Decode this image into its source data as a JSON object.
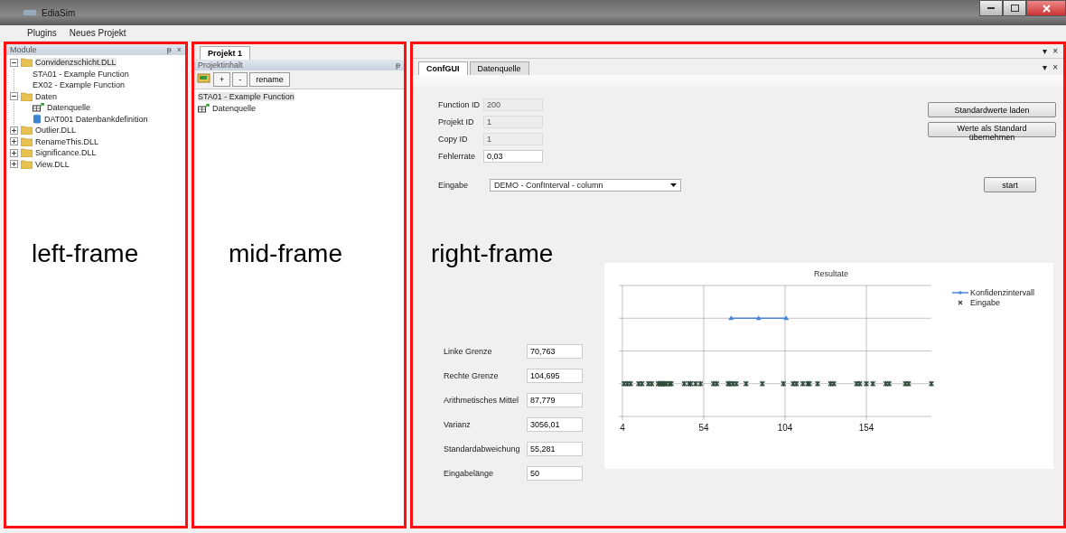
{
  "window": {
    "title": "EdiaSim"
  },
  "menu": [
    "Plugins",
    "Neues Projekt"
  ],
  "left_panel": {
    "title": "Module",
    "pin": "ᵽ",
    "close": "×",
    "annotation": "left-frame",
    "tree": [
      {
        "label": "Convidenzschicht.DLL",
        "kind": "folder",
        "expanded": true,
        "selected": true,
        "children": [
          {
            "label": "STA01 - Example Function",
            "kind": "function",
            "selected": false
          },
          {
            "label": "EX02 - Example Function",
            "kind": "function",
            "selected": false
          }
        ]
      },
      {
        "label": "Daten",
        "kind": "folder",
        "expanded": true,
        "selected": false,
        "children": [
          {
            "label": "Datenquelle",
            "kind": "source",
            "selected": false
          },
          {
            "label": "DAT001 Datenbankdefinition",
            "kind": "database",
            "selected": false
          }
        ]
      },
      {
        "label": "Outlier.DLL",
        "kind": "folder",
        "expanded": false,
        "selected": false
      },
      {
        "label": "RenameThis.DLL",
        "kind": "folder",
        "expanded": false,
        "selected": false
      },
      {
        "label": "Significance.DLL",
        "kind": "folder",
        "expanded": false,
        "selected": false
      },
      {
        "label": "View.DLL",
        "kind": "folder",
        "expanded": false,
        "selected": false
      }
    ]
  },
  "mid_panel": {
    "tabs": [
      {
        "label": "Projekt 1",
        "selected": true
      }
    ],
    "title": "Projektinhalt",
    "pin": "ᵽ",
    "annotation": "mid-frame",
    "toolbar": [
      "+",
      "-",
      "rename"
    ],
    "tree": [
      {
        "label": "STA01 - Example Function",
        "kind": "function",
        "selected": true
      },
      {
        "label": "Datenquelle",
        "kind": "source",
        "selected": false
      }
    ]
  },
  "right_panel": {
    "annotation": "right-frame",
    "top_controls": [
      "▾",
      "×"
    ],
    "tab_controls": [
      "▾",
      "×"
    ],
    "tabs": [
      {
        "label": "ConfGUI",
        "selected": true
      },
      {
        "label": "Datenquelle",
        "selected": false
      }
    ],
    "fields": [
      {
        "label": "Function ID",
        "value": "200",
        "disabled": true
      },
      {
        "label": "Projekt ID",
        "value": "1",
        "disabled": true
      },
      {
        "label": "Copy ID",
        "value": "1",
        "disabled": true
      },
      {
        "label": "Fehlerrate",
        "value": "0,03",
        "disabled": false
      }
    ],
    "buttons": [
      "Standardwerte laden",
      "Werte als Standard übernehmen"
    ],
    "input_select": {
      "label": "Eingabe",
      "value": "DEMO - ConfInterval - column"
    },
    "start_button": "start",
    "results": [
      {
        "label": "Linke Grenze",
        "value": "70,763"
      },
      {
        "label": "Rechte Grenze",
        "value": "104,695"
      },
      {
        "label": "Arithmetisches Mittel",
        "value": "87,779"
      },
      {
        "label": "Varianz",
        "value": "3056,01"
      },
      {
        "label": "Standardabweichung",
        "value": "55,281"
      },
      {
        "label": "Eingabelänge",
        "value": "50"
      }
    ],
    "chart": {
      "title": "Resultate",
      "x_tick_labels": [
        "4",
        "54",
        "104",
        "154"
      ],
      "legend": [
        {
          "label": "Konfidenzintervall",
          "color": "#4a86d8"
        },
        {
          "label": "Eingabe",
          "color": "#2f4a3a"
        }
      ]
    }
  }
}
